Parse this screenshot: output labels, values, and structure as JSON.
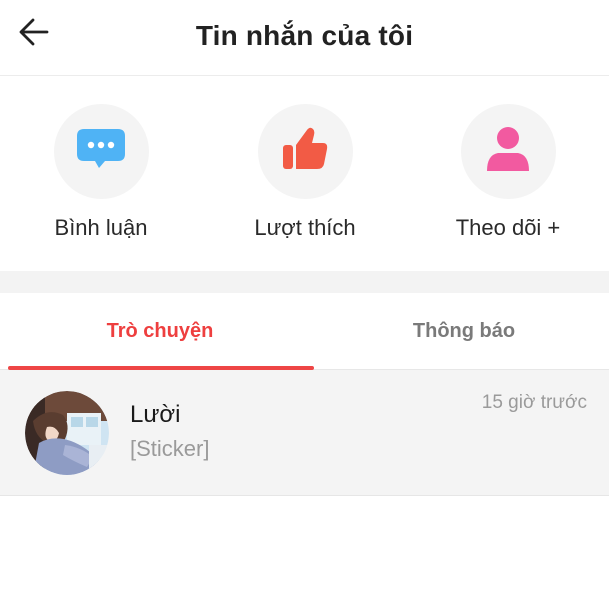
{
  "header": {
    "title": "Tin nhắn của tôi",
    "back_icon": "arrow-left-icon"
  },
  "actions": [
    {
      "label": "Bình luận",
      "icon": "chat-bubble-icon",
      "color": "#4fb3f5"
    },
    {
      "label": "Lượt thích",
      "icon": "thumbs-up-icon",
      "color": "#f25b45"
    },
    {
      "label": "Theo dõi +",
      "icon": "person-icon",
      "color": "#f25aa0"
    }
  ],
  "tabs": [
    {
      "label": "Trò chuyện",
      "active": true
    },
    {
      "label": "Thông báo",
      "active": false
    }
  ],
  "conversations": [
    {
      "name": "Lười",
      "preview": "[Sticker]",
      "time": "15 giờ trước"
    }
  ],
  "colors": {
    "accent": "#ee4545",
    "muted_text": "#9a9a9a"
  }
}
